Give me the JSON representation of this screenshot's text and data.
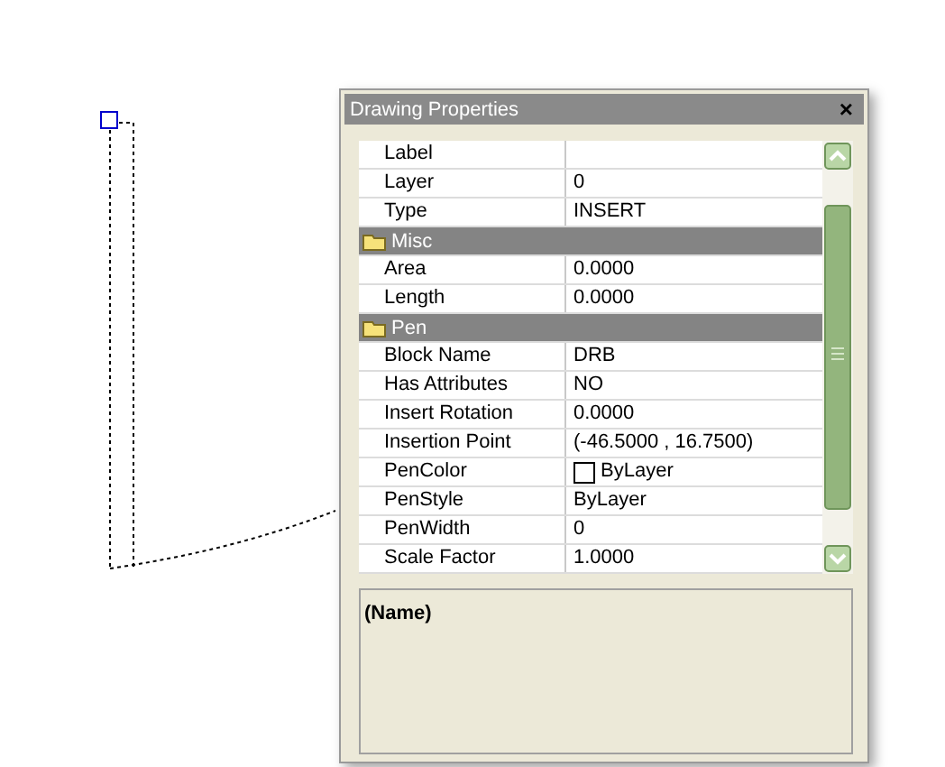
{
  "window": {
    "title": "Drawing Properties",
    "close": "×"
  },
  "properties": [
    {
      "kind": "property",
      "name": "Label"
    },
    {
      "kind": "property",
      "name": "Layer",
      "value": "0"
    },
    {
      "kind": "property",
      "name": "Type",
      "value": "INSERT"
    },
    {
      "kind": "category",
      "name": "Misc"
    },
    {
      "kind": "property",
      "name": "Area",
      "value": "0.0000"
    },
    {
      "kind": "property",
      "name": "Length",
      "value": "0.0000"
    },
    {
      "kind": "category",
      "name": "Pen"
    },
    {
      "kind": "property",
      "name": "Block Name",
      "value": "DRB"
    },
    {
      "kind": "property",
      "name": "Has Attributes",
      "value": "NO"
    },
    {
      "kind": "property",
      "name": "Insert Rotation",
      "value": "0.0000"
    },
    {
      "kind": "property",
      "name": "Insertion Point",
      "value": "(-46.5000 , 16.7500)"
    },
    {
      "kind": "color",
      "name": "PenColor",
      "value": "ByLayer"
    },
    {
      "kind": "property",
      "name": "PenStyle",
      "value": "ByLayer"
    },
    {
      "kind": "property",
      "name": "PenWidth",
      "value": "0"
    },
    {
      "kind": "property",
      "name": "Scale Factor",
      "value": "1.0000"
    }
  ],
  "description": {
    "title": "(Name)"
  }
}
